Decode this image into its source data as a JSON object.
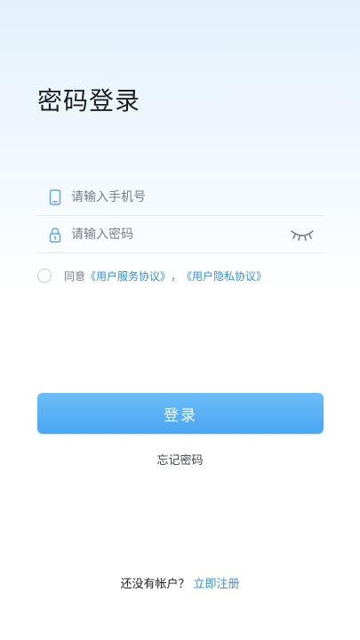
{
  "page": {
    "title": "密码登录"
  },
  "form": {
    "phone_placeholder": "请输入手机号",
    "password_placeholder": "请输入密码",
    "phone_icon": "phone-icon",
    "lock_icon": "lock-icon",
    "eye_icon": "eye-closed-icon"
  },
  "agreement": {
    "prefix": "同意",
    "service_link": "《用户服务协议》",
    "separator": "，",
    "privacy_link": "《用户隐私协议》",
    "checked": false
  },
  "actions": {
    "login_label": "登录",
    "forgot_label": "忘记密码"
  },
  "footer": {
    "no_account_text": "还没有帐户？",
    "register_link": "立即注册"
  },
  "colors": {
    "accent": "#3a8fd9",
    "button": "#5ab1f4",
    "placeholder": "#7a7f88",
    "divider": "#e6e9ee"
  }
}
